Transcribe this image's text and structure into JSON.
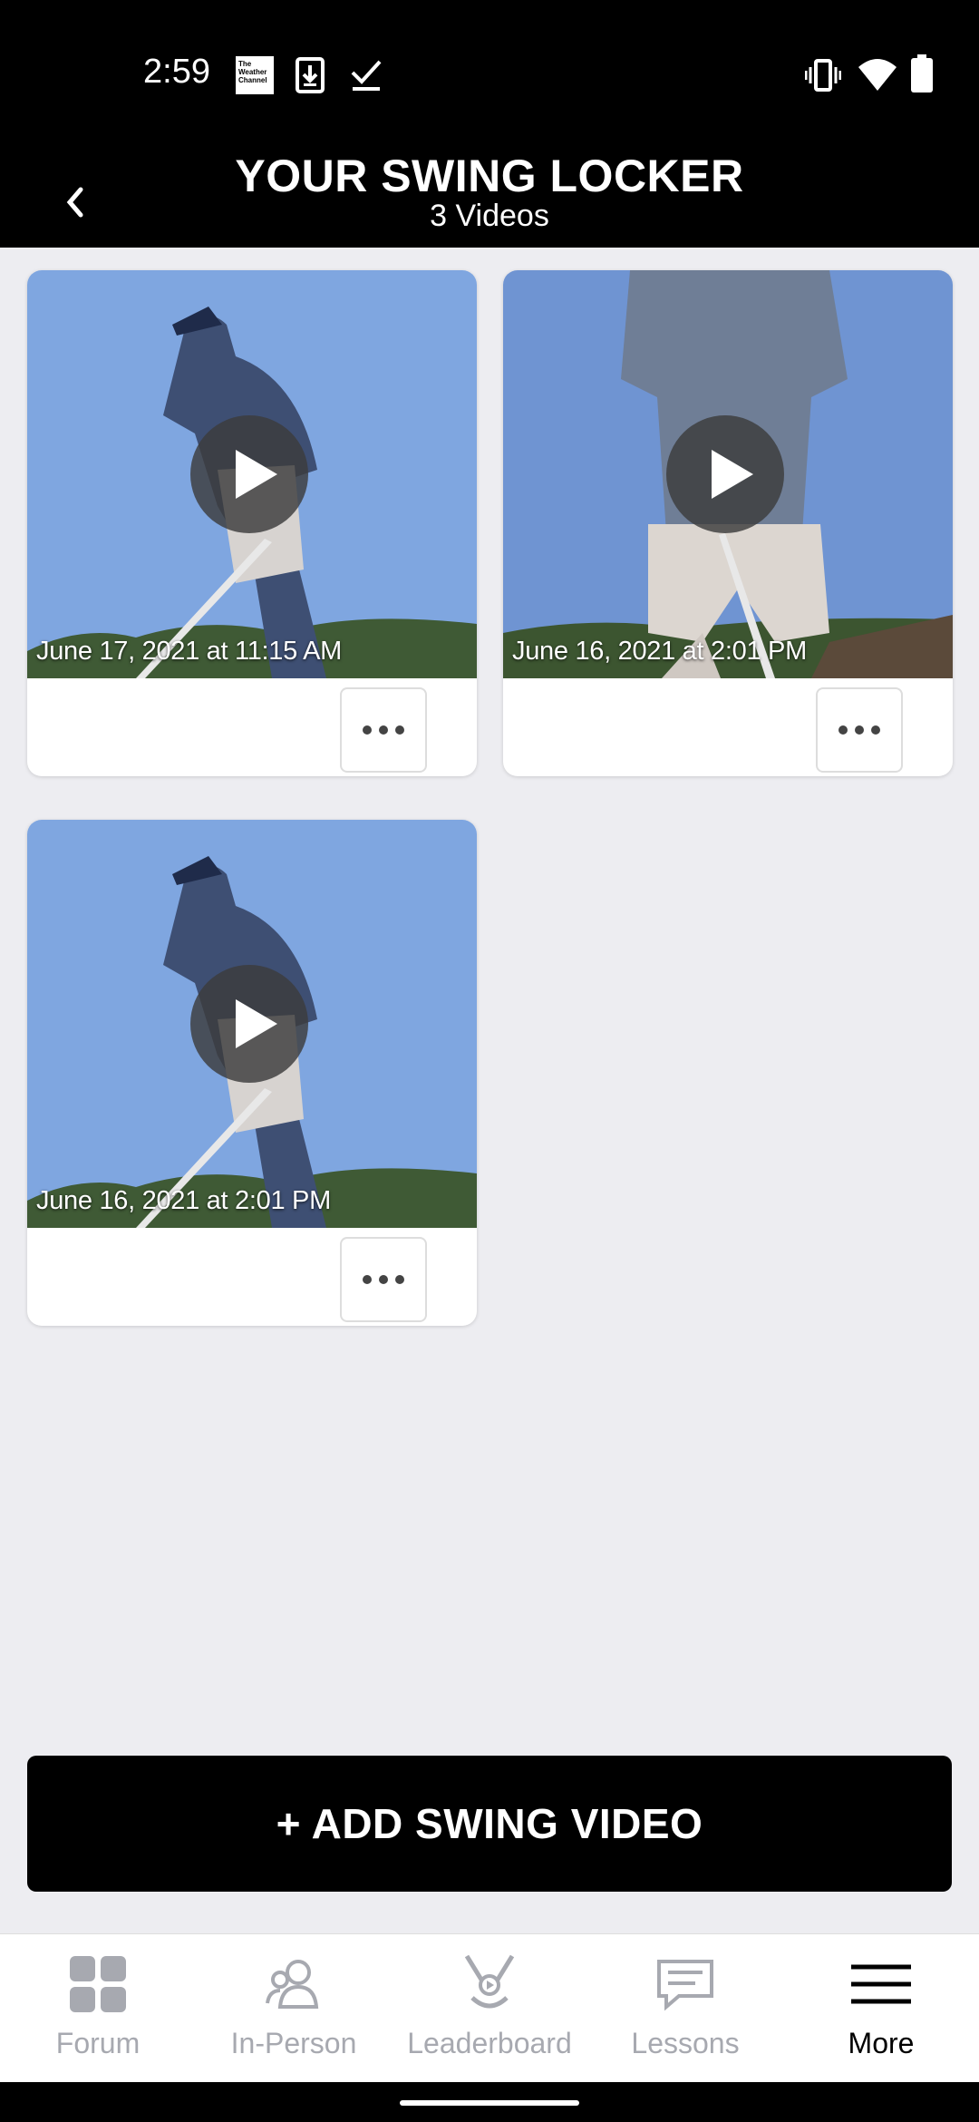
{
  "status_bar": {
    "time": "2:59",
    "twc_logo": "The Weather Channel",
    "icons": [
      "weather-channel-icon",
      "download-icon",
      "check-icon",
      "vibrate-icon",
      "wifi-icon",
      "battery-icon"
    ]
  },
  "header": {
    "title": "YOUR SWING LOCKER",
    "subtitle": "3 Videos",
    "back_icon": "chevron-left-icon"
  },
  "videos": [
    {
      "date": "June 17, 2021 at 11:15 AM",
      "view": "side"
    },
    {
      "date": "June 16, 2021 at 2:01 PM",
      "view": "front"
    },
    {
      "date": "June 16, 2021 at 2:01 PM",
      "view": "side"
    }
  ],
  "add_button": {
    "label": "+ ADD SWING VIDEO"
  },
  "bottom_nav": {
    "items": [
      {
        "label": "Forum",
        "icon": "grid-icon",
        "active": false
      },
      {
        "label": "In-Person",
        "icon": "people-icon",
        "active": false
      },
      {
        "label": "Leaderboard",
        "icon": "golf-clubs-icon",
        "active": false
      },
      {
        "label": "Lessons",
        "icon": "chat-icon",
        "active": false
      },
      {
        "label": "More",
        "icon": "menu-icon",
        "active": true
      }
    ]
  },
  "colors": {
    "background": "#ededf1",
    "header": "#000000",
    "nav_inactive": "#a7a9b0",
    "nav_active": "#000000"
  }
}
